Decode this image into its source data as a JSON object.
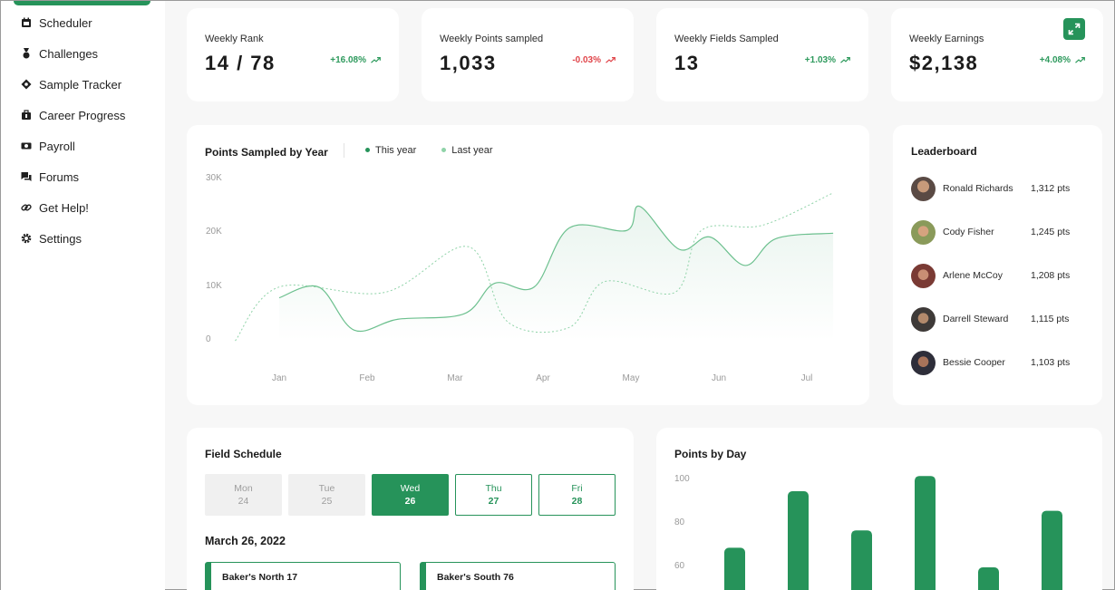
{
  "sidebar": {
    "items": [
      {
        "label": "Scheduler",
        "icon": "calendar-icon"
      },
      {
        "label": "Challenges",
        "icon": "medal-icon"
      },
      {
        "label": "Sample Tracker",
        "icon": "target-icon"
      },
      {
        "label": "Career Progress",
        "icon": "briefcase-icon"
      },
      {
        "label": "Payroll",
        "icon": "money-icon"
      },
      {
        "label": "Forums",
        "icon": "chat-icon"
      },
      {
        "label": "Get Help!",
        "icon": "link-icon"
      },
      {
        "label": "Settings",
        "icon": "gear-icon"
      }
    ]
  },
  "stats": [
    {
      "title": "Weekly Rank",
      "value": "14 / 78",
      "change": "+16.08%",
      "trend": "up"
    },
    {
      "title": "Weekly Points sampled",
      "value": "1,033",
      "change": "-0.03%",
      "trend": "down"
    },
    {
      "title": "Weekly Fields Sampled",
      "value": "13",
      "change": "+1.03%",
      "trend": "up"
    },
    {
      "title": "Weekly Earnings",
      "value": "$2,138",
      "change": "+4.08%",
      "trend": "up"
    }
  ],
  "points_by_year": {
    "title": "Points Sampled by Year",
    "legend_this_year": "This year",
    "legend_last_year": "Last year"
  },
  "leaderboard": {
    "title": "Leaderboard",
    "rows": [
      {
        "name": "Ronald Richards",
        "points": "1,312 pts"
      },
      {
        "name": "Cody Fisher",
        "points": "1,245 pts"
      },
      {
        "name": "Arlene McCoy",
        "points": "1,208 pts"
      },
      {
        "name": "Darrell Steward",
        "points": "1,115 pts"
      },
      {
        "name": "Bessie Cooper",
        "points": "1,103 pts"
      }
    ]
  },
  "field_schedule": {
    "title": "Field Schedule",
    "days": [
      {
        "day": "Mon",
        "num": "24",
        "state": "past"
      },
      {
        "day": "Tue",
        "num": "25",
        "state": "past"
      },
      {
        "day": "Wed",
        "num": "26",
        "state": "active"
      },
      {
        "day": "Thu",
        "num": "27",
        "state": "future"
      },
      {
        "day": "Fri",
        "num": "28",
        "state": "future"
      }
    ],
    "date": "March 26, 2022",
    "items": [
      "Baker's North 17",
      "Baker's South 76"
    ]
  },
  "points_by_day": {
    "title": "Points by Day"
  },
  "colors": {
    "accent": "#26935a",
    "up": "#2e9a5d",
    "down": "#e0454a",
    "last_year_line": "#8fd3a8"
  },
  "chart_data": [
    {
      "type": "line",
      "title": "Points Sampled by Year",
      "categories": [
        "Jan",
        "Feb",
        "Mar",
        "Apr",
        "May",
        "Jun",
        "Jul"
      ],
      "y_ticks": [
        "0",
        "10K",
        "20K",
        "30K"
      ],
      "ylim": [
        0,
        30000
      ],
      "x": [
        0,
        0.45,
        0.85,
        1.35,
        2.1,
        2.45,
        2.9,
        3.3,
        3.95,
        4.1,
        4.55,
        4.9,
        5.3,
        5.65,
        6.3
      ],
      "series": [
        {
          "name": "This year",
          "values": [
            8000,
            10000,
            2000,
            4000,
            5000,
            10700,
            10000,
            21000,
            20500,
            25000,
            17000,
            19300,
            14000,
            19000,
            20000
          ]
        },
        {
          "name": "Last year",
          "x": [
            -0.5,
            0,
            1.2,
            2.15,
            2.6,
            3.3,
            3.7,
            4.5,
            4.8,
            5.5,
            6.3
          ],
          "values": [
            0,
            10000,
            9000,
            17500,
            3500,
            2500,
            11000,
            9000,
            20500,
            21500,
            27500
          ]
        }
      ]
    },
    {
      "type": "bar",
      "title": "Points by Day",
      "y_ticks": [
        "60",
        "80",
        "100"
      ],
      "values": [
        69,
        95,
        77,
        102,
        60,
        86
      ]
    }
  ]
}
